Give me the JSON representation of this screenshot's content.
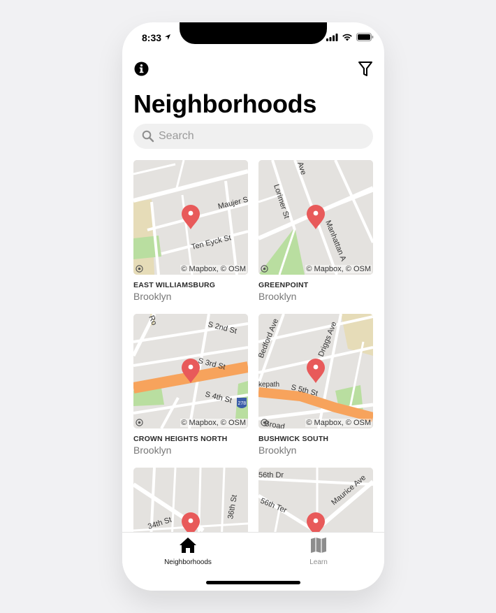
{
  "status_bar": {
    "time": "8:33"
  },
  "header": {
    "info_icon": "info-circle-icon",
    "filter_icon": "funnel-filter-icon",
    "title": "Neighborhoods"
  },
  "search": {
    "placeholder": "Search",
    "value": ""
  },
  "map_attribution": "© Mapbox, © OSM",
  "neighborhoods": [
    {
      "name": "EAST WILLIAMSBURG",
      "borough": "Brooklyn",
      "streets": [
        "Maujer S",
        "Ten Eyck St"
      ]
    },
    {
      "name": "GREENPOINT",
      "borough": "Brooklyn",
      "streets": [
        "Lorimer St",
        "Ave",
        "Manhattan A"
      ]
    },
    {
      "name": "CROWN HEIGHTS NORTH",
      "borough": "Brooklyn",
      "streets": [
        "S 2nd St",
        "S 3rd St",
        "S 4th St",
        "Ro",
        "278"
      ]
    },
    {
      "name": "BUSHWICK SOUTH",
      "borough": "Brooklyn",
      "streets": [
        "Bedford Ave",
        "Driggs Ave",
        "S 5th St",
        "kepath",
        "Broad"
      ]
    },
    {
      "name": "",
      "borough": "",
      "streets": [
        "34th St",
        "36th St"
      ]
    },
    {
      "name": "",
      "borough": "",
      "streets": [
        "56th Dr",
        "56th Ter",
        "Maurice Ave"
      ]
    }
  ],
  "tabs": [
    {
      "label": "Neighborhoods",
      "icon": "home-icon",
      "active": true
    },
    {
      "label": "Learn",
      "icon": "book-map-icon",
      "active": false
    }
  ],
  "colors": {
    "pin": "#e85a5a",
    "highway": "#f7a35c",
    "park": "#b9dea0",
    "land": "#e4e2df",
    "road": "#ffffff"
  }
}
